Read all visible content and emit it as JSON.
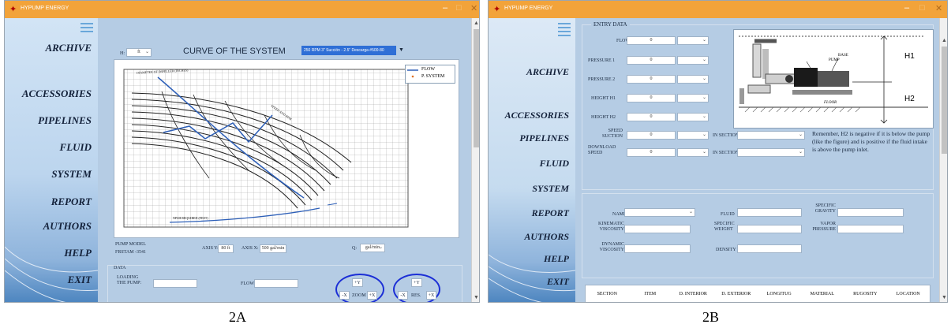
{
  "left": {
    "title": "HYPUMP ENERGY",
    "menu": [
      "ARCHIVE",
      "ACCESSORIES",
      "PIPELINES",
      "FLUID",
      "SYSTEM",
      "REPORT",
      "AUTHORS",
      "HELP",
      "EXIT"
    ],
    "unit_label": "H:",
    "unit_value": "ft",
    "chart_title": "CURVE OF THE SYSTEM",
    "pump_select": "250 RPM 3\" Succión - 2.5\" Descarga #500-80",
    "legend": [
      "FLOW",
      "P. SYSTEM"
    ],
    "impeller_label": "DIAMETER OF IMPELLER (INCHES)",
    "curve_labels": [
      "SPEED AND RPM"
    ],
    "bottom_label": "NPSH REQUIRED (FEET)",
    "pump_model_label": "PUMP MODEL",
    "pump_model_value": "FRSTAM -3541",
    "axis_y_label": "AXIS Y:",
    "axis_y_value": "80 ft",
    "axis_x_label": "AXIS X:",
    "axis_x_value": "500 gal/min",
    "q_label": "Q:",
    "q_value": "gal/min",
    "data_label": "DATA",
    "loading_label": "LOADING THE PUMP:",
    "flow_label": "FLOW:",
    "zoom": {
      "up": "+Y",
      "left": "-X",
      "text": "ZOOM",
      "right": "+X"
    },
    "res": {
      "up": "+Y",
      "left": "-X",
      "text": "RES.",
      "right": "+X"
    },
    "caption": "2A"
  },
  "right": {
    "title": "HYPUMP ENERGY",
    "menu": [
      "ARCHIVE",
      "ACCESSORIES",
      "PIPELINES",
      "FLUID",
      "SYSTEM",
      "REPORT",
      "AUTHORS",
      "HELP",
      "EXIT"
    ],
    "entry_title": "ENTRY DATA",
    "fields": [
      {
        "label": "FLOW",
        "value": "0"
      },
      {
        "label": "PRESSURE 1",
        "value": "0"
      },
      {
        "label": "PRESSURE 2",
        "value": "0"
      },
      {
        "label": "HEIGHT H1",
        "value": "0"
      },
      {
        "label": "HEIGHT H2",
        "value": "0"
      },
      {
        "label": "SPEED SUCTION",
        "value": "0"
      },
      {
        "label": "DOWNLOAD SPEED",
        "value": "0"
      }
    ],
    "section_label": "IN SECTION",
    "figure": {
      "h1": "H1",
      "h2": "H2",
      "base": "BASE",
      "pump": "PUMP",
      "floor": "FLOOR"
    },
    "note": "Remember, H2 is negative if it is below the pump (like the figure) and is positive if the fluid intake is above the pump inlet.",
    "fluid_fields": {
      "name": "NAME",
      "fluid": "FLUID",
      "specific_gravity": "SPECIFIC GRAVITY",
      "kinematic": "KINEMATIC VISCOSITY",
      "specific_weight": "SPECIFIC WEIGHT",
      "vapor": "VAPOR PRESSURE",
      "dynamic": "DYNAMIC VISCOSITY",
      "density": "DENSITY"
    },
    "table_headers": [
      "SECTION",
      "ITEM",
      "D. INTERIOR",
      "D. EXTERIOR",
      "LONGITUG",
      "MATERIAL",
      "RUGOSITY",
      "LOCATION"
    ],
    "caption": "2B"
  }
}
